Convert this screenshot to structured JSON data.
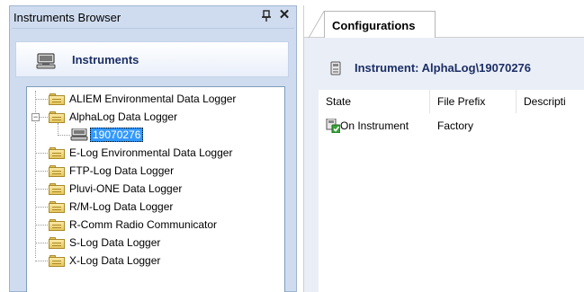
{
  "browser": {
    "title": "Instruments Browser",
    "header": "Instruments",
    "tree": {
      "items": [
        {
          "label": "ALIEM Environmental Data Logger"
        },
        {
          "label": "AlphaLog Data Logger",
          "expanded": true,
          "children": [
            {
              "label": "19070276",
              "selected": true
            }
          ]
        },
        {
          "label": "E-Log Environmental Data Logger"
        },
        {
          "label": "FTP-Log Data Logger"
        },
        {
          "label": "Pluvi-ONE Data Logger"
        },
        {
          "label": "R/M-Log Data Logger"
        },
        {
          "label": "R-Comm Radio Communicator"
        },
        {
          "label": "S-Log Data Logger"
        },
        {
          "label": "X-Log Data Logger"
        }
      ]
    },
    "icons": {
      "pin": "pin-icon",
      "close": "close-icon"
    }
  },
  "configurations": {
    "tab_label": "Configurations",
    "instrument_label": "Instrument: AlphaLog\\19070276",
    "columns": [
      "State",
      "File Prefix",
      "Descripti"
    ],
    "rows": [
      {
        "state": "On Instrument",
        "file_prefix": "Factory",
        "description": ""
      }
    ]
  },
  "colors": {
    "panel_bg": "#cfdcef",
    "header_text": "#1c2f66",
    "selection": "#3399ff"
  }
}
